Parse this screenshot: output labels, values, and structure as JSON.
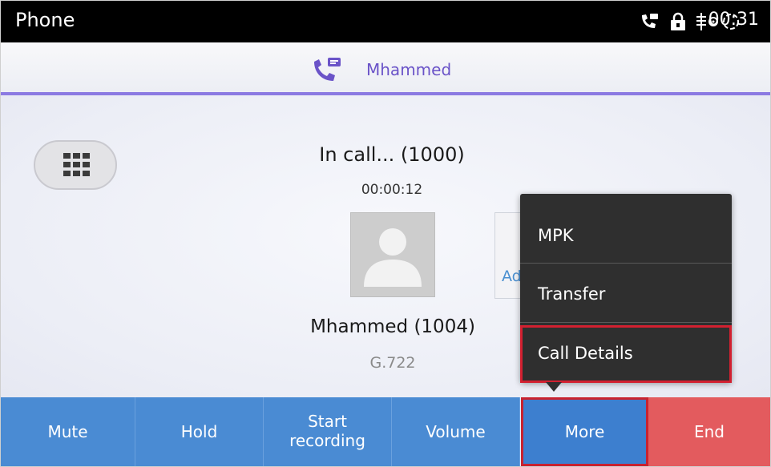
{
  "status_bar": {
    "app_title": "Phone",
    "clock": "00:31",
    "icons": [
      "call-forward-icon",
      "lock-icon",
      "usb-debug-icon",
      "sync-icon"
    ]
  },
  "caller_bar": {
    "icon": "phone-with-message-icon",
    "name": "Mhammed"
  },
  "call": {
    "status": "In call... (1000)",
    "timer": "00:00:12",
    "contact": "Mhammed (1004)",
    "codec": "G.722",
    "add_conf": "Add to conf"
  },
  "menu": {
    "items": [
      "MPK",
      "Transfer",
      "Call Details"
    ]
  },
  "bottom_bar": {
    "mute": "Mute",
    "hold": "Hold",
    "start_recording_line1": "Start",
    "start_recording_line2": "recording",
    "volume": "Volume",
    "more": "More",
    "end": "End"
  },
  "colors": {
    "accent": "#8b7ae2",
    "button": "#4a8bd3",
    "end_button": "#e35b5e",
    "highlight": "#d22030"
  }
}
